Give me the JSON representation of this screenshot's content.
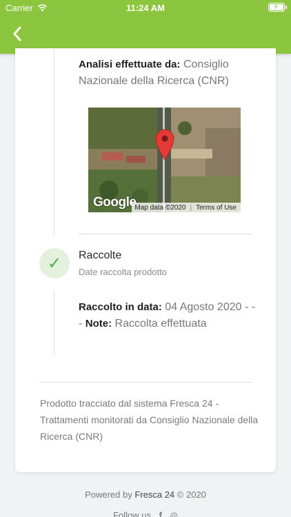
{
  "status_bar": {
    "carrier": "Carrier",
    "time": "11:24 AM"
  },
  "nav": {
    "back_icon": "chevron-left-icon"
  },
  "analysis": {
    "label": "Analisi effettuate da:",
    "value": " Consiglio Nazionale della Ricerca (CNR)"
  },
  "map": {
    "logo": "Google",
    "attribution": "Map data ©2020",
    "terms": "Terms of Use",
    "pin_color": "#e53935"
  },
  "step": {
    "icon": "checkmark-icon",
    "title": "Raccolte",
    "subtitle": "Date raccolta prodotto",
    "harvest_label": "Raccolto in data:",
    "harvest_value": " 04 Agosto 2020 - -- ",
    "note_label": "Note:",
    "note_value": " Raccolta effettuata"
  },
  "footer_note": "Prodotto tracciato dal sistema Fresca 24 - Trattamenti monitorati da Consiglio Nazionale della Ricerca (CNR)",
  "powered_by": {
    "label": "Powered by",
    "brand": "Fresca 24",
    "year": "© 2020"
  },
  "follow": {
    "label": "Follow us"
  },
  "colors": {
    "brand_green": "#8cc63f",
    "check_green": "#4caf50"
  }
}
